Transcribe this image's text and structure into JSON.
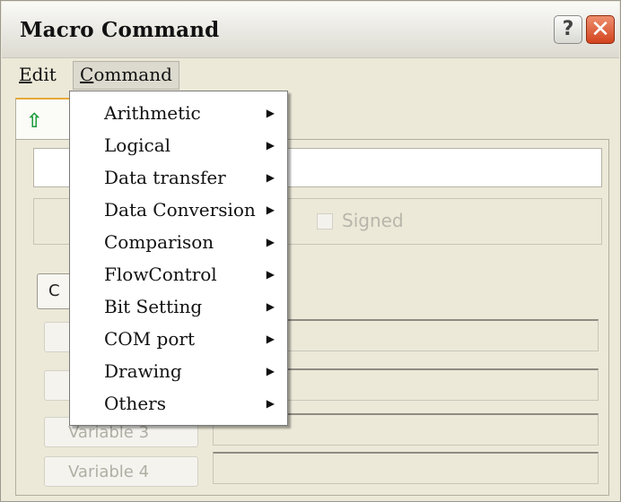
{
  "window": {
    "title": "Macro Command"
  },
  "titlebar_buttons": {
    "help": "?",
    "close": "✕"
  },
  "menubar": {
    "edit": {
      "mnemonic": "E",
      "rest": "dit"
    },
    "command": {
      "mnemonic": "C",
      "rest": "ommand"
    }
  },
  "toolbar": {
    "move_up_icon": "⇧"
  },
  "options": {
    "signed_label": "Signed"
  },
  "command_button_label": "C",
  "variables": [
    "",
    "",
    "Variable 3",
    "Variable 4"
  ],
  "context_menu": {
    "items": [
      "Arithmetic",
      "Logical",
      "Data transfer",
      "Data Conversion",
      "Comparison",
      "FlowControl",
      "Bit Setting",
      "COM port",
      "Drawing",
      "Others"
    ],
    "submenu_icon": "▶"
  },
  "colors": {
    "dialog_bg": "#ece9d8",
    "close_button": "#d2431e",
    "tab_accent": "#e8a838",
    "up_arrow": "#1b9b3a",
    "disabled_text": "#b1afa4"
  }
}
